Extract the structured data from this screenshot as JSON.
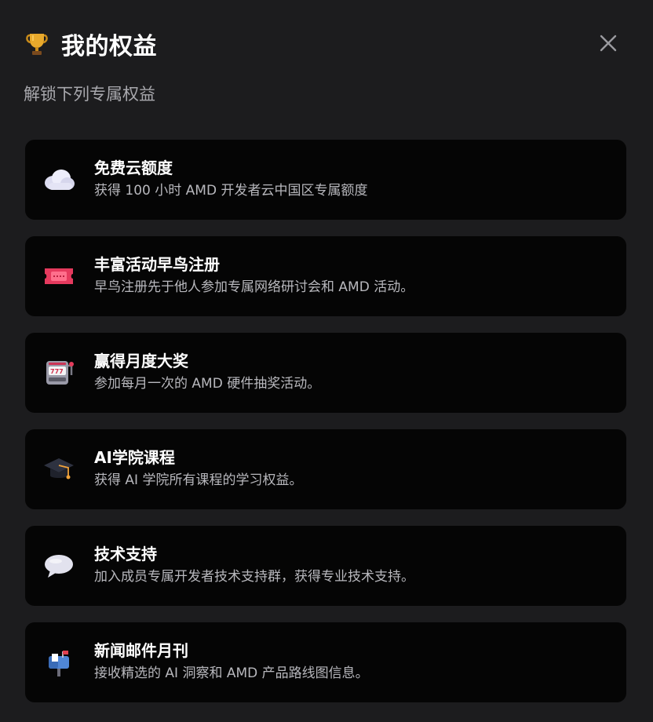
{
  "header": {
    "title": "我的权益",
    "icon": "trophy-icon",
    "close_icon": "close-icon"
  },
  "subtitle": "解锁下列专属权益",
  "benefits": [
    {
      "icon": "cloud-icon",
      "title": "免费云额度",
      "desc": "获得 100 小时 AMD 开发者云中国区专属额度"
    },
    {
      "icon": "ticket-icon",
      "title": "丰富活动早鸟注册",
      "desc": "早鸟注册先于他人参加专属网络研讨会和 AMD 活动。"
    },
    {
      "icon": "slot-machine-icon",
      "title": "赢得月度大奖",
      "desc": "参加每月一次的 AMD 硬件抽奖活动。"
    },
    {
      "icon": "graduation-cap-icon",
      "title": "AI学院课程",
      "desc": "获得 AI 学院所有课程的学习权益。"
    },
    {
      "icon": "speech-bubble-icon",
      "title": "技术支持",
      "desc": "加入成员专属开发者技术支持群，获得专业技术支持。"
    },
    {
      "icon": "mailbox-icon",
      "title": "新闻邮件月刊",
      "desc": "接收精选的 AI 洞察和 AMD 产品路线图信息。"
    }
  ]
}
